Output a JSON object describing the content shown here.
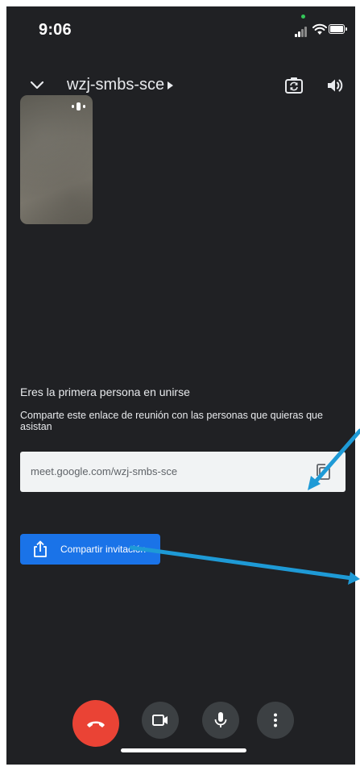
{
  "status_bar": {
    "time": "9:06",
    "icons": [
      "signal-icon",
      "wifi-icon",
      "battery-icon"
    ]
  },
  "header": {
    "meeting_code": "wzj-smbs-sce",
    "icons": [
      "chevron-down-icon",
      "caret-right-icon",
      "switch-camera-icon",
      "speaker-icon"
    ]
  },
  "info": {
    "title": "Eres la primera persona en unirse",
    "subtitle": "Comparte este enlace de reunión con las personas que quieras que asistan",
    "link": "meet.google.com/wzj-smbs-sce"
  },
  "share": {
    "label": "Compartir invitación",
    "icon": "share-icon"
  },
  "controls": {
    "icons": [
      "end-call-icon",
      "camera-icon",
      "microphone-icon",
      "more-vert-icon"
    ]
  },
  "colors": {
    "background": "#202124",
    "accent": "#1a73e8",
    "end_call": "#ea4335",
    "control_bg": "#3c4043",
    "link_box": "#f1f3f4",
    "annotation_arrow": "#1e9ad6"
  }
}
